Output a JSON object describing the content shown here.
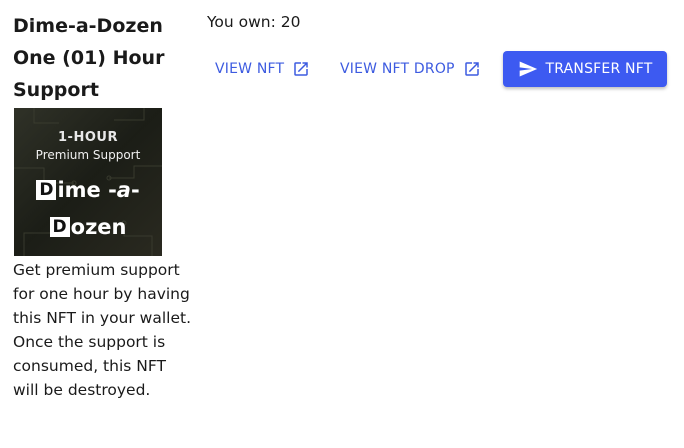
{
  "nft": {
    "title": "Dime-a-Dozen One (01) Hour Support",
    "description": "Get premium support for one hour by having this NFT in your wallet. Once the support is consumed, this NFT will be destroyed.",
    "image": {
      "heading": "1-HOUR",
      "subheading": "Premium Support",
      "logo_line1_box": "D",
      "logo_line1_rest": "ime -",
      "logo_line1_italic": "a",
      "logo_line1_end": "-",
      "logo_line2_box": "D",
      "logo_line2_rest": "ozen"
    }
  },
  "ownership": {
    "text": "You own: 20"
  },
  "actions": {
    "view_nft_label": "VIEW NFT",
    "view_drop_label": "VIEW NFT DROP",
    "transfer_label": "TRANSFER NFT",
    "view_nft_icon": "open-in-new-icon",
    "view_drop_icon": "open-in-new-icon",
    "transfer_icon": "send-icon"
  },
  "colors": {
    "accent": "#3d5af1",
    "link": "#3d5be0",
    "text": "#1a1a1a"
  }
}
